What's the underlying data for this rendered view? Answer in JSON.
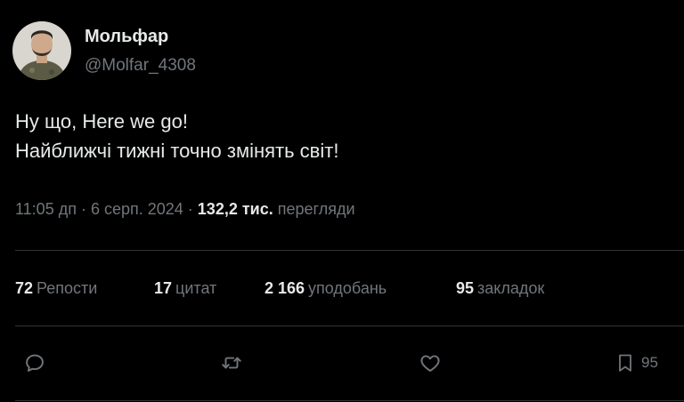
{
  "author": {
    "display_name": "Мольфар",
    "handle": "@Molfar_4308",
    "avatar_icon": "avatar-photo"
  },
  "tweet": {
    "lines": [
      "Ну що, Here we go!",
      "Найближчі тижні точно змінять світ!"
    ]
  },
  "meta": {
    "time": "11:05 дп",
    "separator": "·",
    "date": "6 серп. 2024",
    "views_count": "132,2 тис.",
    "views_label": "перегляди"
  },
  "stats": {
    "reposts": {
      "count": "72",
      "label": "Репости"
    },
    "quotes": {
      "count": "17",
      "label": "цитат"
    },
    "likes": {
      "count": "2 166",
      "label": "уподобань"
    },
    "bookmarks": {
      "count": "95",
      "label": "закладок"
    }
  },
  "actions": {
    "reply_icon": "reply-icon",
    "repost_icon": "repost-icon",
    "like_icon": "heart-icon",
    "bookmark_icon": "bookmark-icon",
    "bookmark_count": "95"
  },
  "colors": {
    "background": "#000000",
    "text_primary": "#e7e9ea",
    "text_secondary": "#71767b",
    "divider": "#2f3336"
  }
}
